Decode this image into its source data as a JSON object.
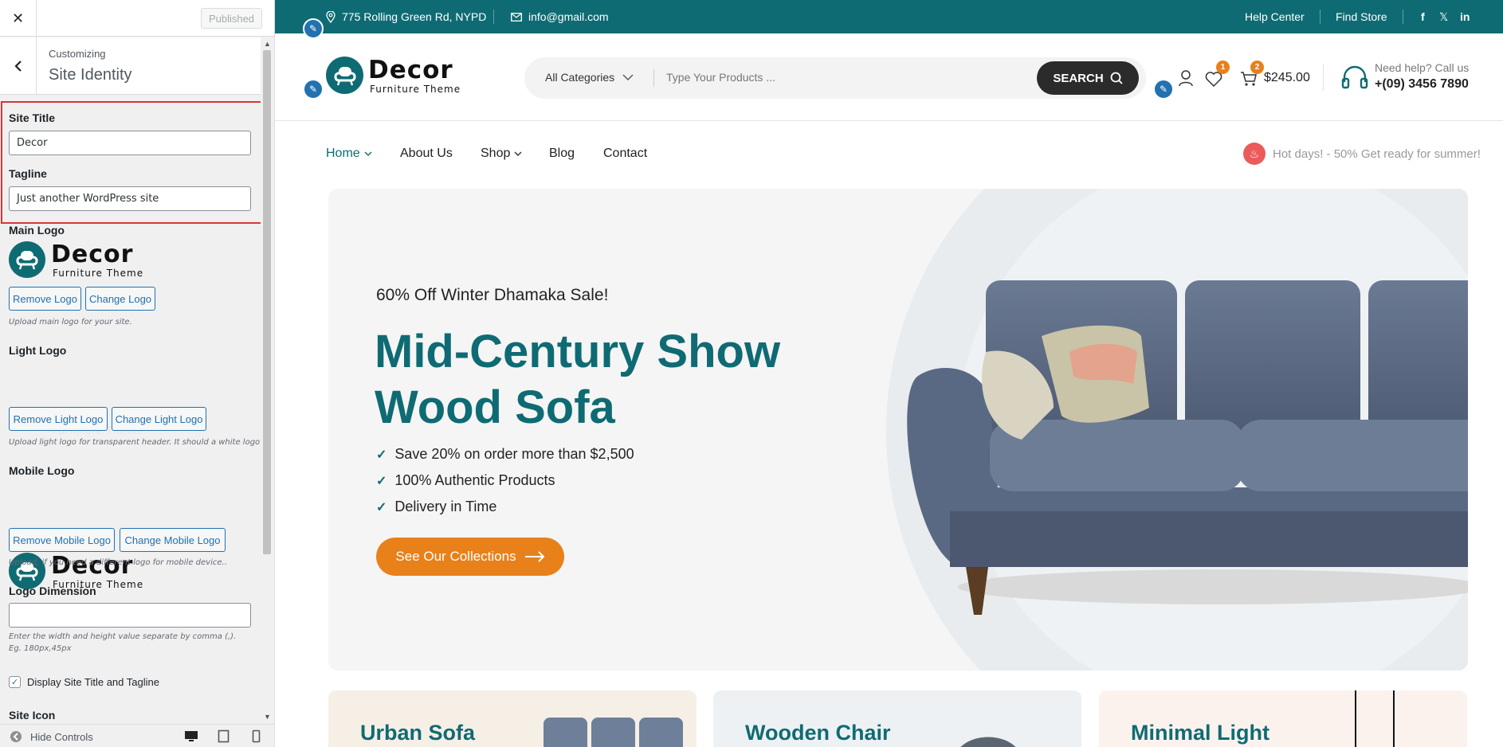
{
  "customizer": {
    "close_icon": "close-icon",
    "published_label": "Published",
    "customizing_label": "Customizing",
    "section_title": "Site Identity",
    "site_title_label": "Site Title",
    "site_title_value": "Decor",
    "tagline_label": "Tagline",
    "tagline_value": "Just another WordPress site",
    "main_logo_label": "Main Logo",
    "remove_logo": "Remove Logo",
    "change_logo": "Change Logo",
    "main_logo_desc": "Upload main logo for your site.",
    "light_logo_label": "Light Logo",
    "remove_light_logo": "Remove Light Logo",
    "change_light_logo": "Change Light Logo",
    "light_logo_desc": "Upload light logo for transparent header. It should a white logo",
    "mobile_logo_label": "Mobile Logo",
    "remove_mobile_logo": "Remove Mobile Logo",
    "change_mobile_logo": "Change Mobile Logo",
    "mobile_logo_desc": "Upload, if you need a different logo for mobile device..",
    "logo_dimension_label": "Logo Dimension",
    "logo_dimension_value": "",
    "logo_dimension_desc": "Enter the width and height value separate by comma (,). Eg. 180px,45px",
    "display_title_label": "Display Site Title and Tagline",
    "display_title_checked": true,
    "site_icon_label": "Site Icon",
    "hide_controls": "Hide Controls"
  },
  "logo": {
    "name": "Decor",
    "subtitle": "Furniture Theme"
  },
  "topbar": {
    "address": "775 Rolling Green Rd, NYPD",
    "email": "info@gmail.com",
    "help_center": "Help Center",
    "find_store": "Find Store",
    "social": [
      "f",
      "𝕏",
      "in"
    ]
  },
  "header": {
    "category_select": "All Categories",
    "search_placeholder": "Type Your Products ...",
    "search_button": "SEARCH",
    "wishlist_count": "1",
    "cart_count": "2",
    "cart_total": "$245.00",
    "help_text": "Need help? Call us",
    "help_phone": "+(09) 3456 7890"
  },
  "nav": {
    "items": [
      "Home",
      "About Us",
      "Shop",
      "Blog",
      "Contact"
    ],
    "promo": "Hot days! - 50% Get ready for summer!"
  },
  "hero": {
    "subtitle": "60% Off Winter Dhamaka Sale!",
    "title": "Mid-Century Show Wood Sofa",
    "features": [
      "Save 20% on order more than $2,500",
      "100% Authentic Products",
      "Delivery in Time"
    ],
    "button": "See Our Collections"
  },
  "cards": [
    "Urban Sofa",
    "Wooden Chair",
    "Minimal Light"
  ],
  "colors": {
    "brand": "#0f6b73",
    "accent": "#e8811a",
    "highlight_box": "#d63638",
    "wp_blue": "#2271b1"
  }
}
